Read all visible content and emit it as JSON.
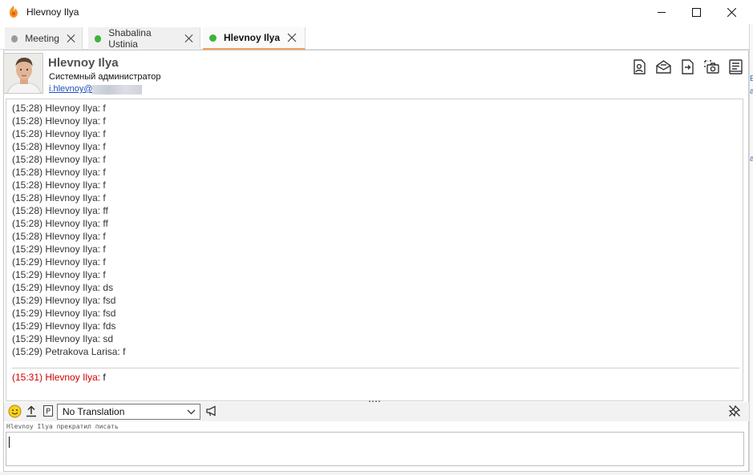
{
  "window": {
    "title": "Hlevnoy Ilya",
    "icon": "flame-app-icon",
    "controls": [
      "minimize-icon",
      "maximize-icon",
      "close-icon"
    ]
  },
  "tabs": [
    {
      "label": "Meeting",
      "status_color": "#9a9a9a",
      "active": false
    },
    {
      "label": "Shabalina Ustinia",
      "status_color": "#3cb43c",
      "active": false
    },
    {
      "label": "Hlevnoy Ilya",
      "status_color": "#3cb43c",
      "active": true
    }
  ],
  "accent_color": "#f0a05a",
  "contact": {
    "name": "Hlevnoy Ilya",
    "role": "Системный администратор",
    "email": "i.hlevnoy@"
  },
  "header_icons": [
    "contact-card-icon",
    "open-mail-icon",
    "send-file-icon",
    "screenshot-icon",
    "history-icon"
  ],
  "messages": [
    {
      "time": "(15:28)",
      "author": "Hlevnoy Ilya:",
      "text": "f"
    },
    {
      "time": "(15:28)",
      "author": "Hlevnoy Ilya:",
      "text": "f"
    },
    {
      "time": "(15:28)",
      "author": "Hlevnoy Ilya:",
      "text": "f"
    },
    {
      "time": "(15:28)",
      "author": "Hlevnoy Ilya:",
      "text": "f"
    },
    {
      "time": "(15:28)",
      "author": "Hlevnoy Ilya:",
      "text": "f"
    },
    {
      "time": "(15:28)",
      "author": "Hlevnoy Ilya:",
      "text": "f"
    },
    {
      "time": "(15:28)",
      "author": "Hlevnoy Ilya:",
      "text": "f"
    },
    {
      "time": "(15:28)",
      "author": "Hlevnoy Ilya:",
      "text": "f"
    },
    {
      "time": "(15:28)",
      "author": "Hlevnoy Ilya:",
      "text": "ff"
    },
    {
      "time": "(15:28)",
      "author": "Hlevnoy Ilya:",
      "text": "ff"
    },
    {
      "time": "(15:28)",
      "author": "Hlevnoy Ilya:",
      "text": "f"
    },
    {
      "time": "(15:29)",
      "author": "Hlevnoy Ilya:",
      "text": "f"
    },
    {
      "time": "(15:29)",
      "author": "Hlevnoy Ilya:",
      "text": "f"
    },
    {
      "time": "(15:29)",
      "author": "Hlevnoy Ilya:",
      "text": "f"
    },
    {
      "time": "(15:29)",
      "author": "Hlevnoy Ilya:",
      "text": "ds"
    },
    {
      "time": "(15:29)",
      "author": "Hlevnoy Ilya:",
      "text": "fsd"
    },
    {
      "time": "(15:29)",
      "author": "Hlevnoy Ilya:",
      "text": "fsd"
    },
    {
      "time": "(15:29)",
      "author": "Hlevnoy Ilya:",
      "text": "fds"
    },
    {
      "time": "(15:29)",
      "author": "Hlevnoy Ilya:",
      "text": "sd"
    },
    {
      "time": "(15:29)",
      "author": "Petrakova Larisa:",
      "text": "f"
    }
  ],
  "latest_message": {
    "time": "(15:31)",
    "author": "Hlevnoy Ilya:",
    "text": "f",
    "color": "#d00000"
  },
  "toolbar": {
    "icons": [
      "smiley-icon",
      "upload-icon",
      "p-box-icon",
      "megaphone-icon",
      "unpin-icon"
    ],
    "translation": {
      "selected": "No Translation"
    }
  },
  "typing_status": "Hlevnoy Ilya прекратил писать",
  "compose": {
    "value": ""
  }
}
